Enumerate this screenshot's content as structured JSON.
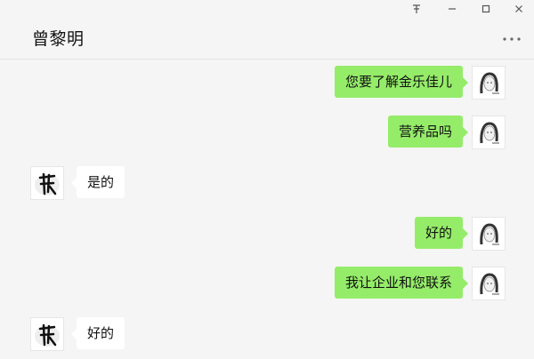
{
  "window": {
    "title": "曾黎明",
    "pin_icon": "pin-icon",
    "minimize_icon": "minimize-icon",
    "maximize_icon": "maximize-icon",
    "close_icon": "close-icon",
    "more_icon": "more-icon"
  },
  "messages": [
    {
      "side": "out",
      "text": "您要了解金乐佳儿"
    },
    {
      "side": "out",
      "text": "营养品吗"
    },
    {
      "side": "in",
      "text": "是的"
    },
    {
      "side": "out",
      "text": "好的"
    },
    {
      "side": "out",
      "text": "我让企业和您联系"
    },
    {
      "side": "in",
      "text": "好的"
    }
  ],
  "colors": {
    "background": "#f5f5f5",
    "outgoing_bubble": "#95ec69",
    "incoming_bubble": "#ffffff"
  }
}
